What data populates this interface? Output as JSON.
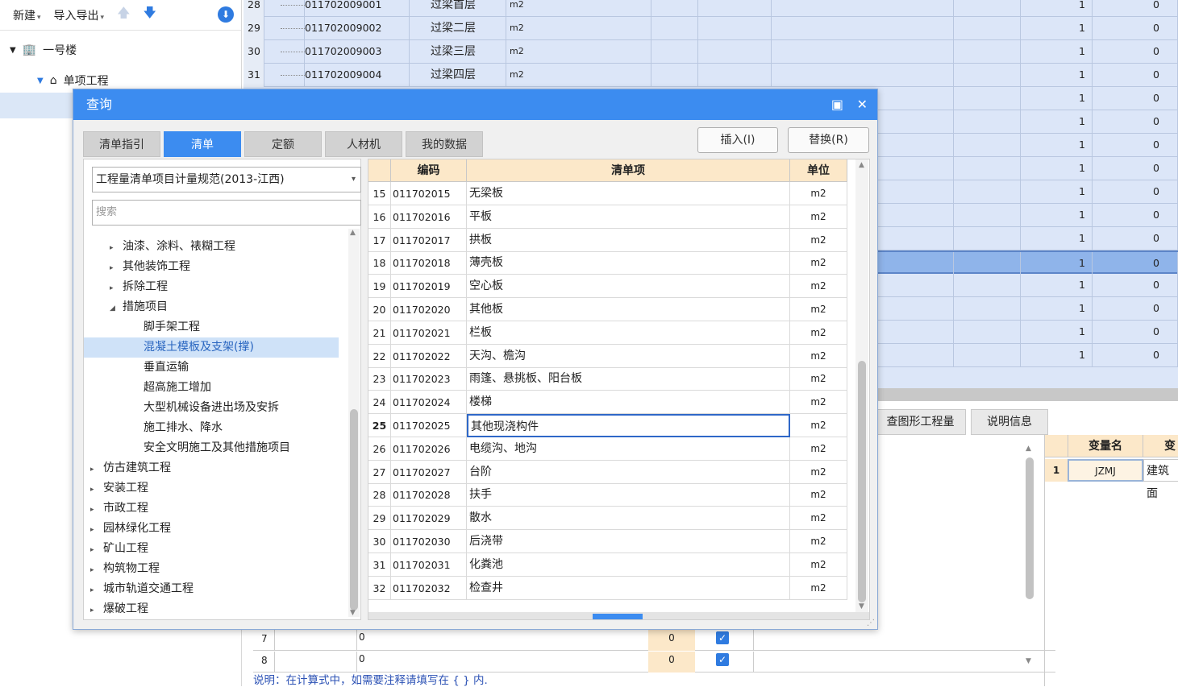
{
  "toolbar": {
    "new_label": "新建",
    "import_label": "导入导出"
  },
  "project_tree": {
    "building": "一号楼",
    "unit": "单项工程"
  },
  "bg_rows": [
    {
      "n": "28",
      "code": "011702009001",
      "name": "过梁首层",
      "unit": "m2",
      "qty": "1",
      "v": "0"
    },
    {
      "n": "29",
      "code": "011702009002",
      "name": "过梁二层",
      "unit": "m2",
      "qty": "1",
      "v": "0"
    },
    {
      "n": "30",
      "code": "011702009003",
      "name": "过梁三层",
      "unit": "m2",
      "qty": "1",
      "v": "0"
    },
    {
      "n": "31",
      "code": "011702009004",
      "name": "过梁四层",
      "unit": "m2",
      "qty": "1",
      "v": "0"
    }
  ],
  "bg_more": [
    {
      "qty": "1",
      "v": "0"
    },
    {
      "qty": "1",
      "v": "0"
    },
    {
      "qty": "1",
      "v": "0"
    },
    {
      "qty": "1",
      "v": "0"
    },
    {
      "qty": "1",
      "v": "0"
    },
    {
      "qty": "1",
      "v": "0"
    },
    {
      "qty": "1",
      "v": "0"
    },
    {
      "qty": "1",
      "v": "0"
    },
    {
      "qty": "1",
      "v": "0"
    },
    {
      "qty": "1",
      "v": "0"
    },
    {
      "qty": "1",
      "v": "0"
    },
    {
      "qty": "1",
      "v": "0"
    }
  ],
  "bottom_tabs": {
    "graph_qty": "查图形工程量",
    "desc_info": "说明信息"
  },
  "var_table": {
    "header_name": "变量名",
    "header_val": "变",
    "row_no": "1",
    "var": "JZMJ",
    "val": "建筑面"
  },
  "bottom_grid": [
    {
      "n": "7",
      "f": "0",
      "v": "0"
    },
    {
      "n": "8",
      "f": "0",
      "v": "0"
    }
  ],
  "note": "说明：在计算式中，如需要注释请填写在 { } 内.",
  "dialog": {
    "title": "查询",
    "tabs": [
      "清单指引",
      "清单",
      "定额",
      "人材机",
      "我的数据"
    ],
    "active_tab": "清单",
    "insert_label": "插入(I)",
    "replace_label": "替换(R)",
    "spec_select": "工程量清单项目计量规范(2013-江西)",
    "search_placeholder": "搜索",
    "tree": [
      {
        "label": "油漆、涂料、裱糊工程",
        "level": 1,
        "state": "collapsed"
      },
      {
        "label": "其他装饰工程",
        "level": 1,
        "state": "collapsed"
      },
      {
        "label": "拆除工程",
        "level": 1,
        "state": "collapsed"
      },
      {
        "label": "措施项目",
        "level": 1,
        "state": "expanded"
      },
      {
        "label": "脚手架工程",
        "level": 2,
        "state": "leaf"
      },
      {
        "label": "混凝土模板及支架(撑)",
        "level": 2,
        "state": "leaf",
        "selected": true
      },
      {
        "label": "垂直运输",
        "level": 2,
        "state": "leaf"
      },
      {
        "label": "超高施工增加",
        "level": 2,
        "state": "leaf"
      },
      {
        "label": "大型机械设备进出场及安拆",
        "level": 2,
        "state": "leaf"
      },
      {
        "label": "施工排水、降水",
        "level": 2,
        "state": "leaf"
      },
      {
        "label": "安全文明施工及其他措施项目",
        "level": 2,
        "state": "leaf"
      },
      {
        "label": "仿古建筑工程",
        "level": 0,
        "state": "collapsed"
      },
      {
        "label": "安装工程",
        "level": 0,
        "state": "collapsed"
      },
      {
        "label": "市政工程",
        "level": 0,
        "state": "collapsed"
      },
      {
        "label": "园林绿化工程",
        "level": 0,
        "state": "collapsed"
      },
      {
        "label": "矿山工程",
        "level": 0,
        "state": "collapsed"
      },
      {
        "label": "构筑物工程",
        "level": 0,
        "state": "collapsed"
      },
      {
        "label": "城市轨道交通工程",
        "level": 0,
        "state": "collapsed"
      },
      {
        "label": "爆破工程",
        "level": 0,
        "state": "collapsed"
      }
    ],
    "table_headers": {
      "code": "编码",
      "item": "清单项",
      "unit": "单位"
    },
    "rows": [
      {
        "n": "15",
        "code": "011702015",
        "name": "无梁板",
        "unit": "m2"
      },
      {
        "n": "16",
        "code": "011702016",
        "name": "平板",
        "unit": "m2"
      },
      {
        "n": "17",
        "code": "011702017",
        "name": "拱板",
        "unit": "m2"
      },
      {
        "n": "18",
        "code": "011702018",
        "name": "薄壳板",
        "unit": "m2"
      },
      {
        "n": "19",
        "code": "011702019",
        "name": "空心板",
        "unit": "m2"
      },
      {
        "n": "20",
        "code": "011702020",
        "name": "其他板",
        "unit": "m2"
      },
      {
        "n": "21",
        "code": "011702021",
        "name": "栏板",
        "unit": "m2"
      },
      {
        "n": "22",
        "code": "011702022",
        "name": "天沟、檐沟",
        "unit": "m2"
      },
      {
        "n": "23",
        "code": "011702023",
        "name": "雨篷、悬挑板、阳台板",
        "unit": "m2"
      },
      {
        "n": "24",
        "code": "011702024",
        "name": "楼梯",
        "unit": "m2"
      },
      {
        "n": "25",
        "code": "011702025",
        "name": "其他现浇构件",
        "unit": "m2",
        "current": true
      },
      {
        "n": "26",
        "code": "011702026",
        "name": "电缆沟、地沟",
        "unit": "m2"
      },
      {
        "n": "27",
        "code": "011702027",
        "name": "台阶",
        "unit": "m2"
      },
      {
        "n": "28",
        "code": "011702028",
        "name": "扶手",
        "unit": "m2"
      },
      {
        "n": "29",
        "code": "011702029",
        "name": "散水",
        "unit": "m2"
      },
      {
        "n": "30",
        "code": "011702030",
        "name": "后浇带",
        "unit": "m2"
      },
      {
        "n": "31",
        "code": "011702031",
        "name": "化粪池",
        "unit": "m2"
      },
      {
        "n": "32",
        "code": "011702032",
        "name": "检查井",
        "unit": "m2"
      }
    ]
  }
}
